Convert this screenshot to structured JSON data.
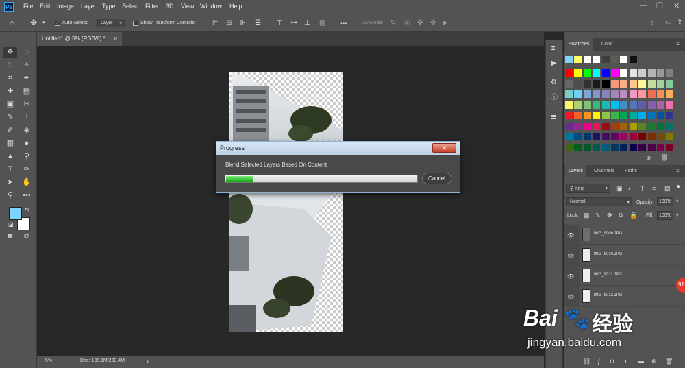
{
  "app": {
    "logo": "Ps"
  },
  "menu": [
    "File",
    "Edit",
    "Image",
    "Layer",
    "Type",
    "Select",
    "Filter",
    "3D",
    "View",
    "Window",
    "Help"
  ],
  "window_controls": {
    "minimize": "—",
    "restore": "❐",
    "close": "✕"
  },
  "options_bar": {
    "auto_select_label": "Auto-Select:",
    "auto_select_checked": true,
    "auto_select_target": "Layer",
    "show_transform_label": "Show Transform Controls",
    "more_label": "•••",
    "mode_3d_label": "3D Mode:"
  },
  "document_tab": {
    "title": "Untitled1 @ 5% (RGB/8) *",
    "close": "×"
  },
  "status_bar": {
    "zoom": "5%",
    "doc_info": "Doc: 135.1M/233.4M",
    "arrow": "›"
  },
  "dialog": {
    "title": "Progress",
    "message": "Blend Selected Layers Based On Content",
    "progress": 0.14,
    "cancel_label": "Cancel",
    "close_label": "✕"
  },
  "swatches_panel": {
    "tabs": [
      "Swatches",
      "Color"
    ],
    "recent": [
      "#7fd3ff",
      "#ffff66",
      "#ffffff",
      "#ffffff",
      "#3d3d3d",
      "#5c5a55",
      "#ffffff",
      "#111111"
    ],
    "colors": [
      "#ff0000",
      "#ffff00",
      "#00ff00",
      "#00ffff",
      "#0000ff",
      "#ff00ff",
      "#ffffff",
      "#e6e6e6",
      "#cccccc",
      "#b3b3b3",
      "#999999",
      "#808080",
      "#666666",
      "#4d4d4d",
      "#333333",
      "#1a1a1a",
      "#000000",
      "#f7977a",
      "#f9ad81",
      "#fdc68a",
      "#fff79a",
      "#c4df9b",
      "#a3d39c",
      "#82ca9d",
      "#7bcdc8",
      "#6ecff6",
      "#7ea7d8",
      "#8493ca",
      "#8882be",
      "#a187be",
      "#bc8dbf",
      "#f49ac2",
      "#f6989d",
      "#f26c4f",
      "#f68e55",
      "#fbaf5c",
      "#fff467",
      "#acd372",
      "#7cc576",
      "#3bb878",
      "#1abbb4",
      "#00bff3",
      "#438ccb",
      "#5574b9",
      "#605ca8",
      "#855fa8",
      "#a763a8",
      "#f06eaa",
      "#ed1c24",
      "#f26522",
      "#f7941d",
      "#fff200",
      "#8dc73f",
      "#39b54a",
      "#00a651",
      "#00a99d",
      "#00aeef",
      "#0072bc",
      "#0054a6",
      "#2e3192",
      "#662d91",
      "#92278f",
      "#ec008c",
      "#ed145b",
      "#9e0b0f",
      "#a0410d",
      "#a36209",
      "#aba000",
      "#598527",
      "#197b30",
      "#007236",
      "#00746b",
      "#0076a3",
      "#004b80",
      "#003471",
      "#1b1464",
      "#440e62",
      "#630460",
      "#9e005d",
      "#9e0039",
      "#790000",
      "#7b2e00",
      "#7d4900",
      "#827b00",
      "#406618",
      "#005e20",
      "#005826",
      "#005952",
      "#005b7f",
      "#003663",
      "#002157",
      "#0d004c",
      "#32004b",
      "#4b0049",
      "#7b0046",
      "#7a0026"
    ]
  },
  "layers_panel": {
    "tabs": [
      "Layers",
      "Channels",
      "Paths"
    ],
    "filter_kind": "Kind",
    "blend_mode": "Normal",
    "opacity_label": "Opacity:",
    "opacity": "100%",
    "lock_label": "Lock:",
    "fill_label": "Fill:",
    "fill": "100%",
    "layers": [
      {
        "name": "IMG_9009.JPG",
        "visible": true
      },
      {
        "name": "IMG_9010.JPG",
        "visible": true
      },
      {
        "name": "IMG_9011.JPG",
        "visible": true
      },
      {
        "name": "IMG_9012.JPG",
        "visible": true
      }
    ]
  },
  "overlay": {
    "badge": "91",
    "watermark_brand": "Bai",
    "watermark_cn": "经验",
    "watermark_url": "jingyan.baidu.com"
  }
}
